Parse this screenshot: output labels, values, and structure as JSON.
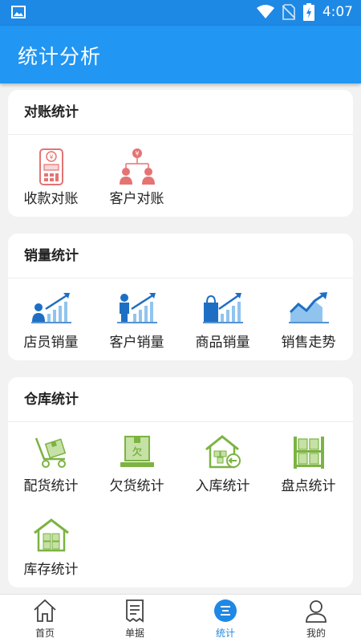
{
  "status_bar": {
    "time": "4:07",
    "icons": [
      "image-icon",
      "wifi-icon",
      "no-sim-icon",
      "battery-charging-icon"
    ]
  },
  "app_bar": {
    "title": "统计分析"
  },
  "sections": {
    "reconciliation": {
      "title": "对账统计",
      "items": [
        {
          "label": "收款对账",
          "icon": "payment-reconcile-icon"
        },
        {
          "label": "客户对账",
          "icon": "customer-reconcile-icon"
        }
      ]
    },
    "sales": {
      "title": "销量统计",
      "items": [
        {
          "label": "店员销量",
          "icon": "clerk-sales-icon"
        },
        {
          "label": "客户销量",
          "icon": "customer-sales-icon"
        },
        {
          "label": "商品销量",
          "icon": "product-sales-icon"
        },
        {
          "label": "销售走势",
          "icon": "sales-trend-icon"
        }
      ]
    },
    "warehouse": {
      "title": "仓库统计",
      "items": [
        {
          "label": "配货统计",
          "icon": "distribution-icon"
        },
        {
          "label": "欠货统计",
          "icon": "backorder-icon"
        },
        {
          "label": "入库统计",
          "icon": "inbound-icon"
        },
        {
          "label": "盘点统计",
          "icon": "inventory-check-icon"
        },
        {
          "label": "库存统计",
          "icon": "stock-icon"
        }
      ]
    }
  },
  "tab_bar": {
    "active": "统计",
    "tabs": [
      {
        "label": "首页",
        "icon": "home-icon"
      },
      {
        "label": "单据",
        "icon": "document-icon"
      },
      {
        "label": "统计",
        "icon": "stats-icon"
      },
      {
        "label": "我的",
        "icon": "user-icon"
      }
    ]
  },
  "colors": {
    "primary": "#2196f3",
    "status_bar": "#1e88e5",
    "reconcile_icon": "#e57373",
    "sales_icon": "#1e6fc4",
    "warehouse_icon": "#7cb342",
    "background": "#f2f2f2"
  }
}
